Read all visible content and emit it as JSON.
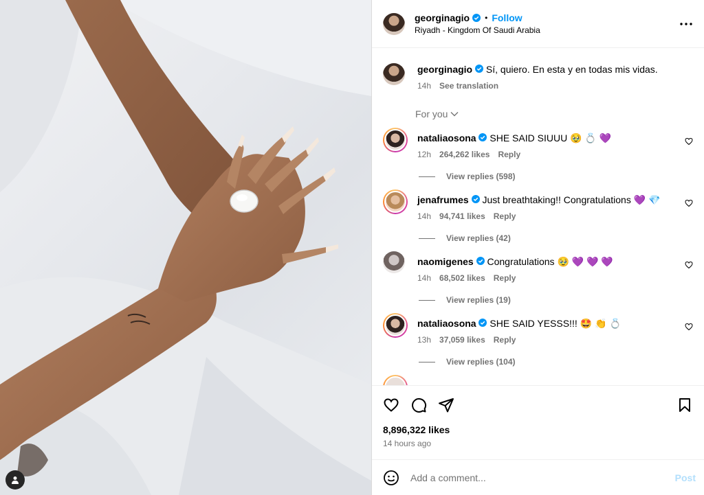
{
  "header": {
    "username": "georginagio",
    "follow_label": "Follow",
    "separator": "•",
    "location": "Riyadh - Kingdom Of Saudi Arabia",
    "more_icon": "more-horizontal-icon"
  },
  "caption": {
    "username": "georginagio",
    "text": "Sí, quiero. En esta y en todas mis vidas.",
    "time": "14h",
    "see_translation": "See translation"
  },
  "for_you_label": "For you",
  "comments": [
    {
      "username": "nataliaosona",
      "text": "SHE SAID SIUUU",
      "emojis": "🥹 💍 💜",
      "time": "12h",
      "likes": "264,262 likes",
      "reply": "Reply",
      "view_replies": "View replies (598)"
    },
    {
      "username": "jenafrumes",
      "text": "Just breathtaking!! Congratulations",
      "emojis": "💜 💎",
      "time": "14h",
      "likes": "94,741 likes",
      "reply": "Reply",
      "view_replies": "View replies (42)"
    },
    {
      "username": "naomigenes",
      "text": "Congratulations",
      "emojis": "🥹 💜 💜 💜",
      "time": "14h",
      "likes": "68,502 likes",
      "reply": "Reply",
      "view_replies": "View replies (19)"
    },
    {
      "username": "nataliaosona",
      "text": "SHE SAID YESSS!!!",
      "emojis": "🤩 👏 💍",
      "time": "13h",
      "likes": "37,059 likes",
      "reply": "Reply",
      "view_replies": "View replies (104)"
    }
  ],
  "actions": {
    "likes": "8,896,322 likes",
    "time_ago": "14 hours ago"
  },
  "add_comment": {
    "placeholder": "Add a comment...",
    "post_label": "Post"
  },
  "colors": {
    "accent": "#0095f6",
    "post_disabled": "#b2dffc",
    "muted": "#737373",
    "verified": "#0095f6"
  }
}
